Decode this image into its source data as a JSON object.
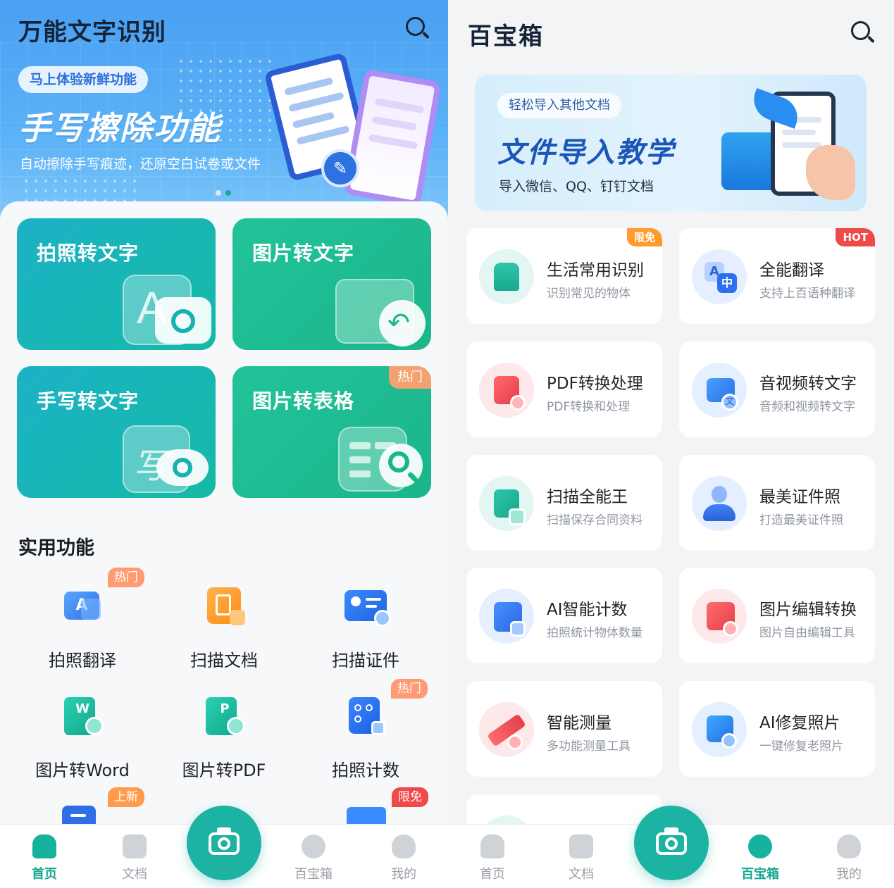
{
  "left": {
    "title": "万能文字识别",
    "banner": {
      "chip": "马上体验新鲜功能",
      "title": "手写擦除功能",
      "subtitle": "自动擦除手写痕迹，还原空白试卷或文件"
    },
    "cards": [
      {
        "label": "拍照转文字"
      },
      {
        "label": "图片转文字"
      },
      {
        "label": "手写转文字"
      },
      {
        "label": "图片转表格",
        "tag": "热门"
      }
    ],
    "section_title": "实用功能",
    "tools": [
      {
        "name": "拍照翻译",
        "tag": "热门",
        "icon": "translate-photo-icon"
      },
      {
        "name": "扫描文档",
        "icon": "scan-document-icon"
      },
      {
        "name": "扫描证件",
        "icon": "scan-id-icon"
      },
      {
        "name": "图片转Word",
        "icon": "word-icon"
      },
      {
        "name": "图片转PDF",
        "icon": "pdf-icon"
      },
      {
        "name": "拍照计数",
        "tag": "热门",
        "icon": "count-icon"
      }
    ],
    "peek_tags": [
      "上新",
      "限免"
    ],
    "tabbar": {
      "home": "首页",
      "docs": "文档",
      "toolbox": "百宝箱",
      "mine": "我的"
    }
  },
  "right": {
    "title": "百宝箱",
    "banner": {
      "chip": "轻松导入其他文档",
      "title": "文件导入教学",
      "subtitle": "导入微信、QQ、钉钉文档"
    },
    "tools": [
      {
        "name": "生活常用识别",
        "desc": "识别常见的物体",
        "tag": "限免",
        "icon": "house-icon"
      },
      {
        "name": "全能翻译",
        "desc": "支持上百语种翻译",
        "tag": "HOT",
        "icon": "translate-icon"
      },
      {
        "name": "PDF转换处理",
        "desc": "PDF转换和处理",
        "icon": "pdf-convert-icon"
      },
      {
        "name": "音视频转文字",
        "desc": "音频和视频转文字",
        "icon": "video-text-icon"
      },
      {
        "name": "扫描全能王",
        "desc": "扫描保存合同资料",
        "icon": "scan-icon"
      },
      {
        "name": "最美证件照",
        "desc": "打造最美证件照",
        "icon": "id-photo-icon"
      },
      {
        "name": "AI智能计数",
        "desc": "拍照统计物体数量",
        "icon": "ai-count-icon"
      },
      {
        "name": "图片编辑转换",
        "desc": "图片自由编辑工具",
        "icon": "image-edit-icon"
      },
      {
        "name": "智能测量",
        "desc": "多功能测量工具",
        "icon": "ruler-icon"
      },
      {
        "name": "AI修复照片",
        "desc": "一键修复老照片",
        "icon": "photo-repair-icon"
      }
    ],
    "tabbar": {
      "home": "首页",
      "docs": "文档",
      "toolbox": "百宝箱",
      "mine": "我的"
    }
  },
  "colors": {
    "accent": "#1db3a3",
    "hot_tag": "#ff8a4c",
    "free_tag": "#ff9a2e",
    "hot_red": "#ef4a4a",
    "header_blue": "#4aa0f2"
  }
}
